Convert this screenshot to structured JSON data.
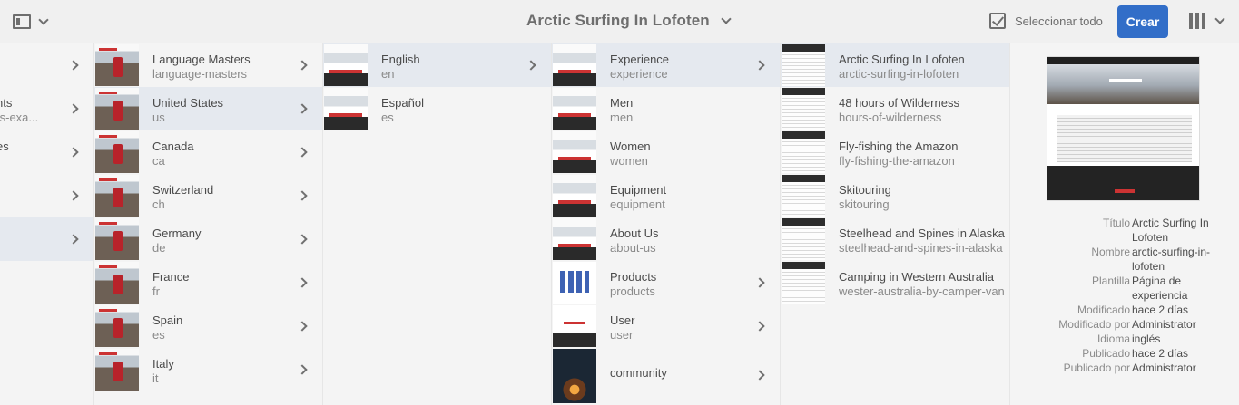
{
  "header": {
    "title": "Arctic Surfing In Lofoten",
    "select_all_label": "Seleccionar todo",
    "create_label": "Crear"
  },
  "columns": [
    {
      "items": [
        {
          "title": "",
          "subtitle": "",
          "chevron": true
        },
        {
          "title": "nts",
          "subtitle": "ts-exa...",
          "chevron": true
        },
        {
          "title": "es",
          "subtitle": "",
          "chevron": true
        },
        {
          "title": "",
          "subtitle": "",
          "chevron": true
        },
        {
          "title": "",
          "subtitle": "",
          "chevron": true,
          "active": true
        }
      ]
    },
    {
      "items": [
        {
          "title": "Language Masters",
          "subtitle": "language-masters",
          "chevron": true
        },
        {
          "title": "United States",
          "subtitle": "us",
          "chevron": true,
          "active": true
        },
        {
          "title": "Canada",
          "subtitle": "ca",
          "chevron": true
        },
        {
          "title": "Switzerland",
          "subtitle": "ch",
          "chevron": true
        },
        {
          "title": "Germany",
          "subtitle": "de",
          "chevron": true
        },
        {
          "title": "France",
          "subtitle": "fr",
          "chevron": true
        },
        {
          "title": "Spain",
          "subtitle": "es",
          "chevron": true
        },
        {
          "title": "Italy",
          "subtitle": "it",
          "chevron": true
        }
      ]
    },
    {
      "items": [
        {
          "title": "English",
          "subtitle": "en",
          "chevron": true,
          "active": true
        },
        {
          "title": "Español",
          "subtitle": "es",
          "chevron": false
        }
      ]
    },
    {
      "items": [
        {
          "title": "Experience",
          "subtitle": "experience",
          "chevron": true,
          "active": true
        },
        {
          "title": "Men",
          "subtitle": "men",
          "chevron": false
        },
        {
          "title": "Women",
          "subtitle": "women",
          "chevron": false
        },
        {
          "title": "Equipment",
          "subtitle": "equipment",
          "chevron": false
        },
        {
          "title": "About Us",
          "subtitle": "about-us",
          "chevron": false
        },
        {
          "title": "Products",
          "subtitle": "products",
          "chevron": true
        },
        {
          "title": "User",
          "subtitle": "user",
          "chevron": true
        },
        {
          "title": "community",
          "subtitle": "",
          "chevron": true
        }
      ]
    },
    {
      "items": [
        {
          "title": "Arctic Surfing In Lofoten",
          "subtitle": "arctic-surfing-in-lofoten",
          "chevron": false,
          "active": true
        },
        {
          "title": "48 hours of Wilderness",
          "subtitle": "hours-of-wilderness",
          "chevron": false
        },
        {
          "title": "Fly-fishing the Amazon",
          "subtitle": "fly-fishing-the-amazon",
          "chevron": false
        },
        {
          "title": "Skitouring",
          "subtitle": "skitouring",
          "chevron": false
        },
        {
          "title": "Steelhead and Spines in Alaska",
          "subtitle": "steelhead-and-spines-in-alaska",
          "chevron": false
        },
        {
          "title": "Camping in Western Australia",
          "subtitle": "wester-australia-by-camper-van",
          "chevron": false
        }
      ]
    }
  ],
  "preview": {
    "meta": [
      {
        "label": "Título",
        "value": "Arctic Surfing In Lofoten"
      },
      {
        "label": "Nombre",
        "value": "arctic-surfing-in-lofoten"
      },
      {
        "label": "Plantilla",
        "value": "Página de experiencia"
      },
      {
        "label": "Modificado",
        "value": "hace 2 días"
      },
      {
        "label": "Modificado por",
        "value": "Administrator"
      },
      {
        "label": "Idioma",
        "value": "inglés"
      },
      {
        "label": "Publicado",
        "value": "hace 2 días"
      },
      {
        "label": "Publicado por",
        "value": "Administrator"
      }
    ]
  },
  "colors": {
    "accent": "#326ec8",
    "active_row": "#e5e9ef"
  },
  "icons": {
    "rail_toggle": "rail-toggle-icon",
    "select_all": "checkbox-icon",
    "view_switch": "column-view-icon",
    "chevron": "chevron-right-icon"
  }
}
